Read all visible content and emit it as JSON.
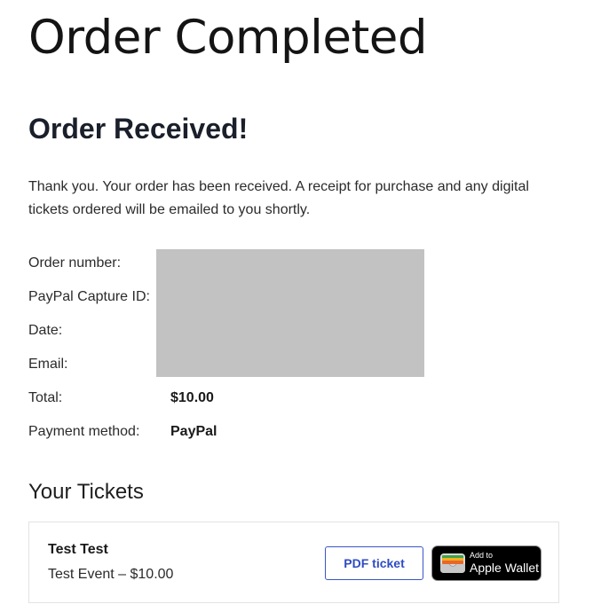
{
  "page": {
    "title": "Order Completed"
  },
  "order": {
    "heading": "Order Received!",
    "message": "Thank you. Your order has been received. A receipt for purchase and any digital tickets ordered will be emailed to you shortly.",
    "details": {
      "order_number_label": "Order number:",
      "paypal_capture_label": "PayPal Capture ID:",
      "date_label": "Date:",
      "email_label": "Email:",
      "total_label": "Total:",
      "total_value": "$10.00",
      "payment_method_label": "Payment method:",
      "payment_method_value": "PayPal"
    },
    "redaction_color": "#c2c2c2"
  },
  "tickets": {
    "heading": "Your Tickets",
    "items": [
      {
        "name": "Test Test",
        "description": "Test Event – $10.00",
        "pdf_button_label": "PDF ticket",
        "wallet_button": {
          "small_label": "Add to",
          "big_label": "Apple Wallet",
          "icon": "apple-wallet-icon"
        }
      }
    ]
  },
  "colors": {
    "pdf_button_accent": "#2f4bc4",
    "wallet_button_background": "#000000"
  }
}
